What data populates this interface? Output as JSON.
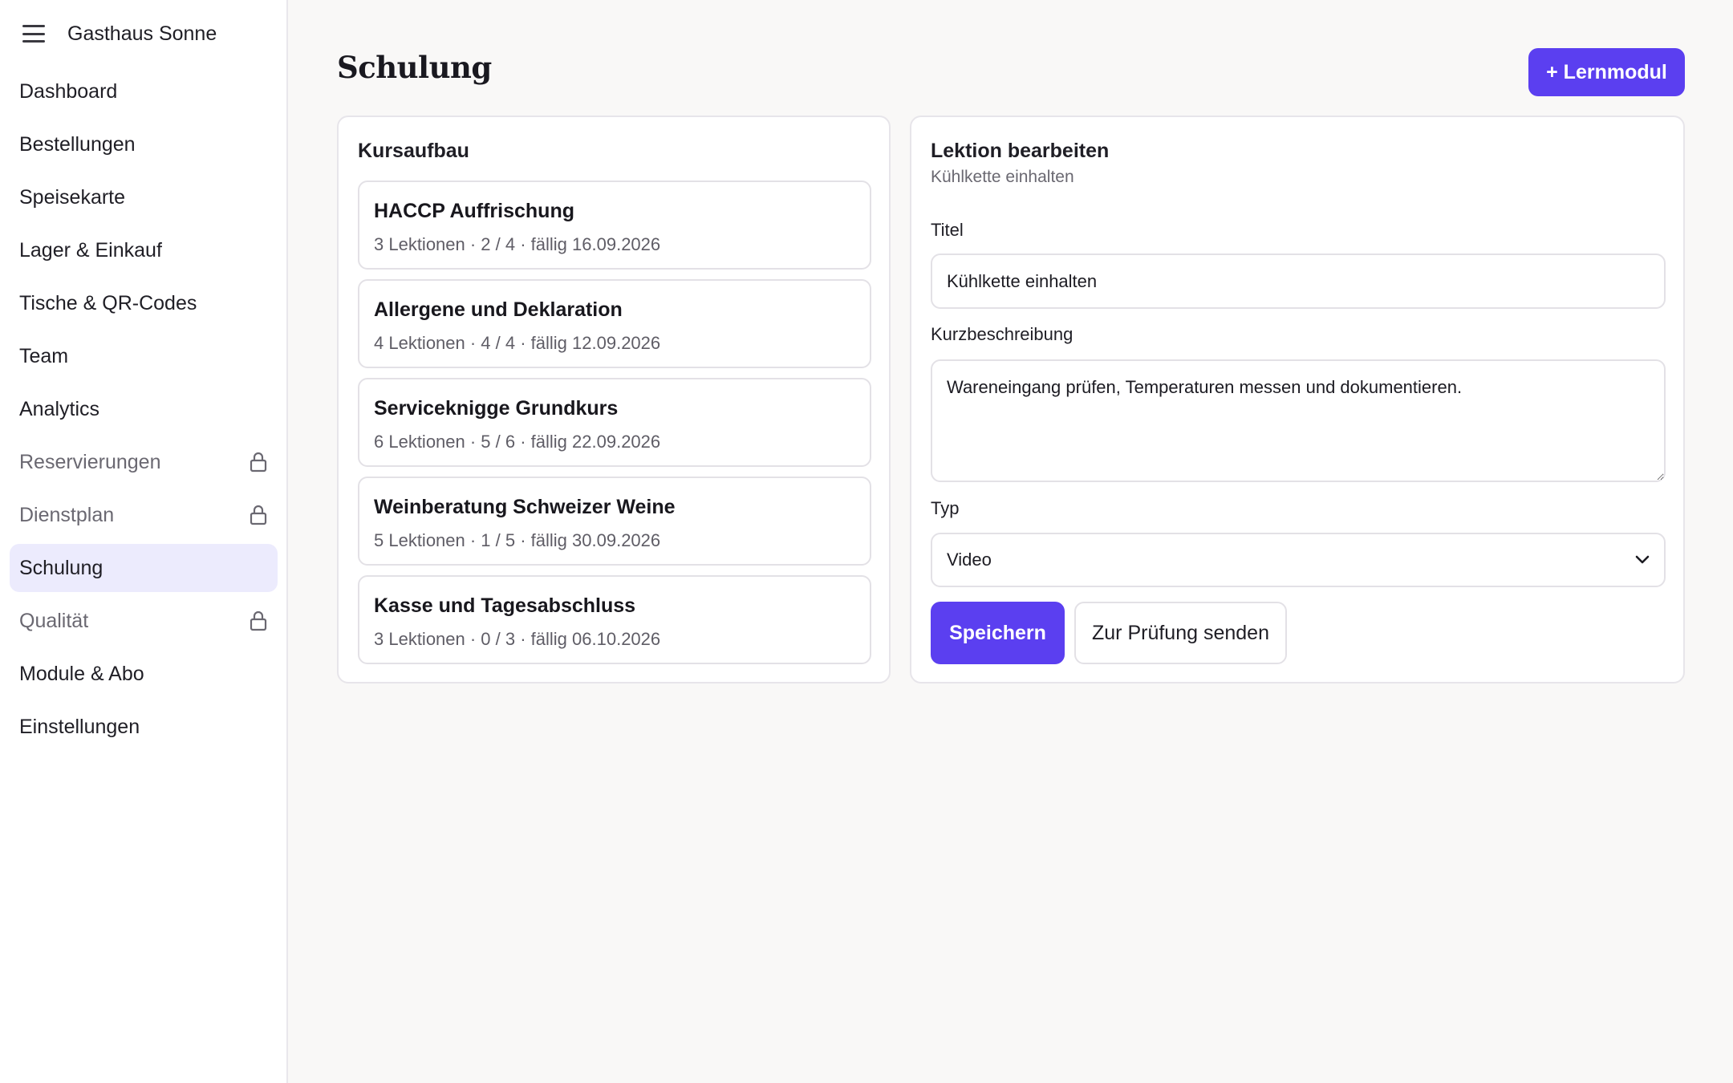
{
  "app": {
    "name": "Gasthaus Sonne"
  },
  "sidebar": {
    "items": [
      {
        "label": "Dashboard",
        "locked": false,
        "active": false
      },
      {
        "label": "Bestellungen",
        "locked": false,
        "active": false
      },
      {
        "label": "Speisekarte",
        "locked": false,
        "active": false
      },
      {
        "label": "Lager & Einkauf",
        "locked": false,
        "active": false
      },
      {
        "label": "Tische & QR-Codes",
        "locked": false,
        "active": false
      },
      {
        "label": "Team",
        "locked": false,
        "active": false
      },
      {
        "label": "Analytics",
        "locked": false,
        "active": false
      },
      {
        "label": "Reservierungen",
        "locked": true,
        "active": false
      },
      {
        "label": "Dienstplan",
        "locked": true,
        "active": false
      },
      {
        "label": "Schulung",
        "locked": false,
        "active": true
      },
      {
        "label": "Qualität",
        "locked": true,
        "active": false
      },
      {
        "label": "Module & Abo",
        "locked": false,
        "active": false
      },
      {
        "label": "Einstellungen",
        "locked": false,
        "active": false
      }
    ]
  },
  "header": {
    "title": "Schulung",
    "add_button": "+ Lernmodul"
  },
  "course_panel": {
    "heading": "Kursaufbau",
    "courses": [
      {
        "title": "HACCP Auffrischung",
        "meta": "3 Lektionen · 2 / 4 · fällig 16.09.2026"
      },
      {
        "title": "Allergene und Deklaration",
        "meta": "4 Lektionen · 4 / 4 · fällig 12.09.2026"
      },
      {
        "title": "Serviceknigge Grundkurs",
        "meta": "6 Lektionen · 5 / 6 · fällig 22.09.2026"
      },
      {
        "title": "Weinberatung Schweizer Weine",
        "meta": "5 Lektionen · 1 / 5 · fällig 30.09.2026"
      },
      {
        "title": "Kasse und Tagesabschluss",
        "meta": "3 Lektionen · 0 / 3 · fällig 06.10.2026"
      }
    ]
  },
  "editor": {
    "heading": "Lektion bearbeiten",
    "subtitle": "Kühlkette einhalten",
    "title_label": "Titel",
    "title_value": "Kühlkette einhalten",
    "description_label": "Kurzbeschreibung",
    "description_value": "Wareneingang prüfen, Temperaturen messen und dokumentieren.",
    "type_label": "Typ",
    "type_value": "Video",
    "save_button": "Speichern",
    "review_button": "Zur Prüfung senden"
  },
  "colors": {
    "accent": "#5b3ff0",
    "active_nav_bg": "#ecebfd",
    "background": "#f9f8f7"
  }
}
